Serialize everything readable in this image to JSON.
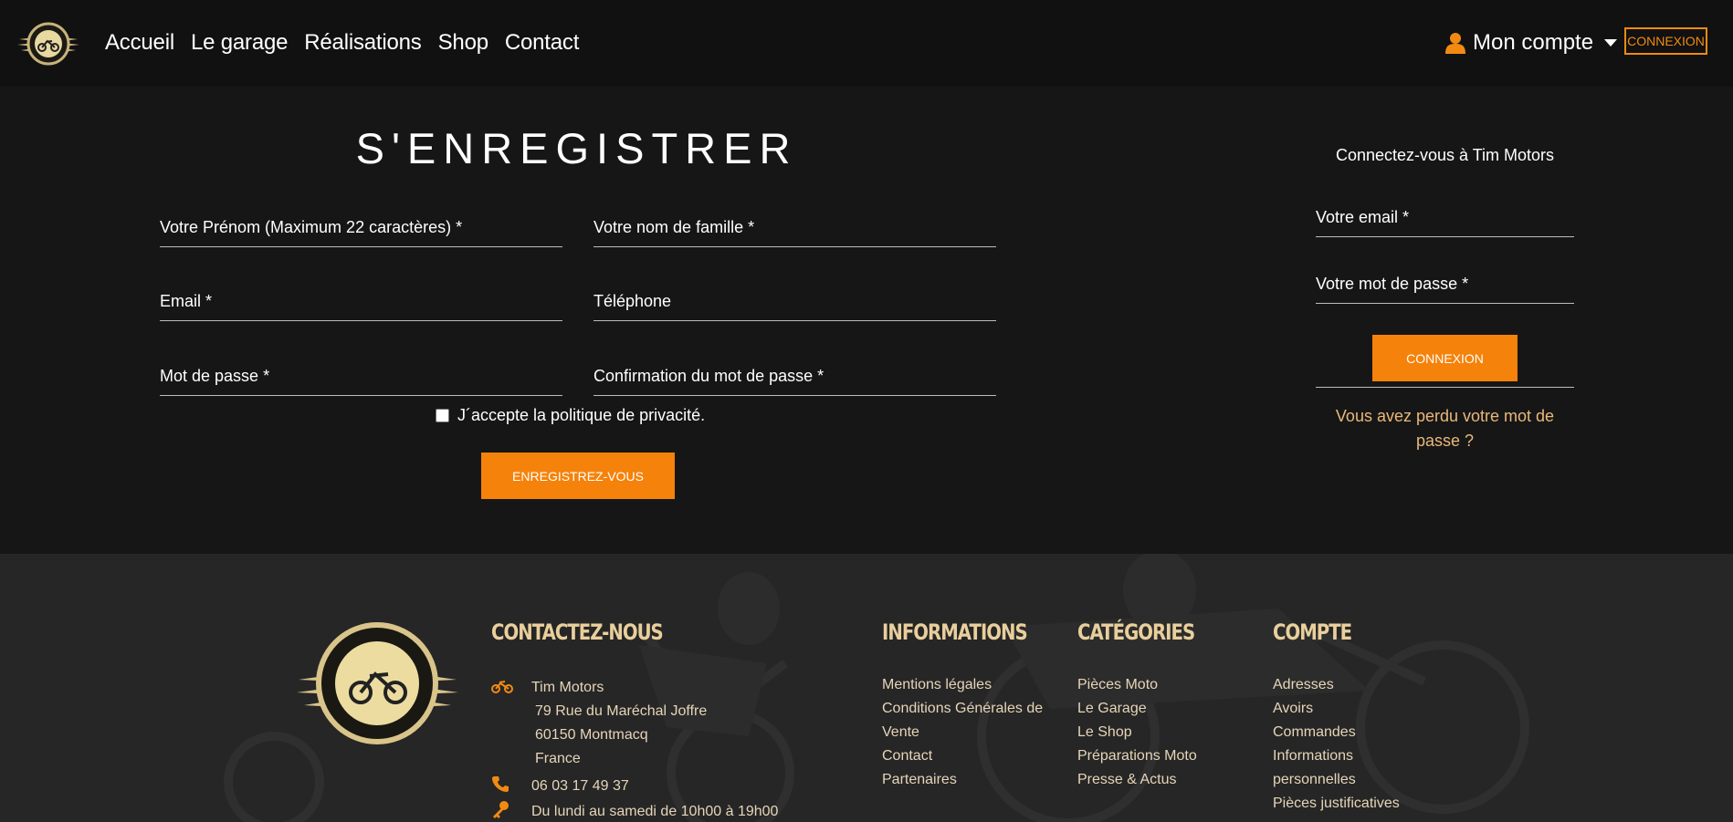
{
  "colors": {
    "accent": "#f5820a",
    "background": "#161616",
    "footer_bg": "#262626",
    "footer_heading": "#e9cf9c",
    "link_lost": "#e9b87a"
  },
  "header": {
    "logo_icon": "tim-motors-logo",
    "nav": [
      "Accueil",
      "Le garage",
      "Réalisations",
      "Shop",
      "Contact"
    ],
    "account_icon": "user-icon",
    "account_label": "Mon compte",
    "connexion_label": "CONNEXION"
  },
  "register": {
    "title": "S'ENREGISTRER",
    "fields": {
      "firstname": "Votre Prénom (Maximum 22 caractères) *",
      "lastname": "Votre nom de famille *",
      "email": "Email *",
      "phone": "Téléphone",
      "password": "Mot de passe *",
      "password_confirm": "Confirmation du mot de passe *"
    },
    "privacy_label": "J´accepte la politique de privacité.",
    "submit_label": "ENREGISTREZ-VOUS"
  },
  "login": {
    "title": "Connectez-vous à Tim Motors",
    "email_placeholder": "Votre email *",
    "password_placeholder": "Votre mot de passe *",
    "submit_label": "CONNEXION",
    "lost_password": "Vous avez perdu votre mot de passe ?"
  },
  "footer": {
    "contact": {
      "heading": "CONTACTEZ-NOUS",
      "company": "Tim Motors",
      "street": "79 Rue du Maréchal Joffre",
      "city": "60150 Montmacq",
      "country": "France",
      "phone": "06 03 17 49 37",
      "hours": "Du lundi au samedi de 10h00 à 19h00"
    },
    "informations": {
      "heading": "INFORMATIONS",
      "items": [
        "Mentions légales",
        "Conditions Générales de",
        "Vente",
        "Contact",
        "Partenaires"
      ]
    },
    "categories": {
      "heading": "CATÉGORIES",
      "items": [
        "Pièces Moto",
        "Le Garage",
        "Le Shop",
        "Préparations Moto",
        "Presse & Actus"
      ]
    },
    "compte": {
      "heading": "COMPTE",
      "items": [
        "Adresses",
        "Avoirs",
        "Commandes",
        "Informations",
        "personnelles",
        "Pièces justificatives"
      ]
    }
  }
}
